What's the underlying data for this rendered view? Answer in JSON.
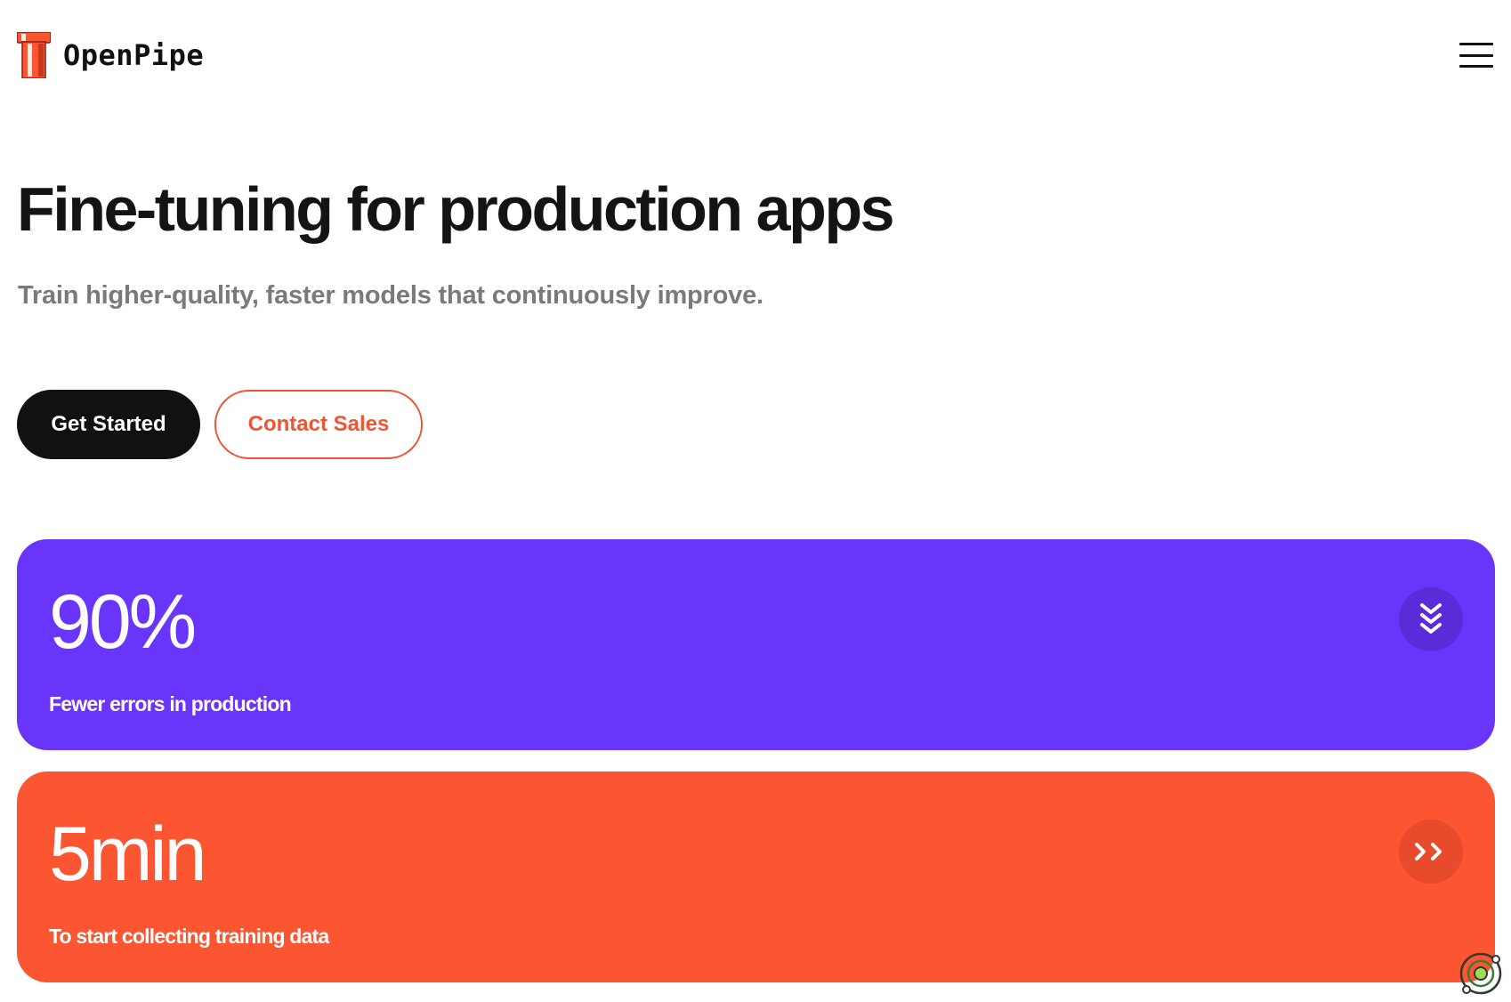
{
  "brand": {
    "name": "OpenPipe",
    "logo_icon": "pipe-logo-icon",
    "logo_colors": [
      "#fc5532",
      "#c8381c"
    ]
  },
  "header": {
    "menu_icon": "hamburger-menu-icon"
  },
  "hero": {
    "title": "Fine-tuning for production apps",
    "subtitle": "Train higher-quality, faster models that continuously improve.",
    "primary_cta": "Get Started",
    "secondary_cta": "Contact Sales"
  },
  "stats": [
    {
      "value": "90%",
      "label": "Fewer errors in production",
      "icon": "double-chevron-down-icon",
      "color": "#6a35fb"
    },
    {
      "value": "5min",
      "label": "To start collecting training data",
      "icon": "double-chevron-right-icon",
      "color": "#fc5532"
    }
  ],
  "colors": {
    "accent": "#fc5532",
    "purple": "#6a35fb",
    "text": "#111111",
    "muted": "#7a7a7a"
  },
  "widget": {
    "icon": "assistant-widget-icon"
  }
}
